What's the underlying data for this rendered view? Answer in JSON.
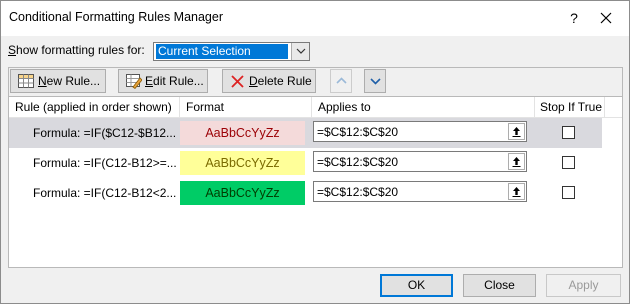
{
  "window": {
    "title": "Conditional Formatting Rules Manager",
    "help": "?"
  },
  "scope": {
    "label": "Show formatting rules for:",
    "selected": "Current Selection"
  },
  "toolbar": {
    "new_rule": "New Rule...",
    "edit_rule": "Edit Rule...",
    "delete_rule": "Delete Rule"
  },
  "table": {
    "headers": [
      "Rule (applied in order shown)",
      "Format",
      "Applies to",
      "Stop If True"
    ],
    "rows": [
      {
        "rule": "Formula: =IF($C12-$B12...",
        "format_preview": "AaBbCcYyZz",
        "format_bg": "#f4dada",
        "format_fg": "#9c0006",
        "applies_to": "=$C$12:$C$20",
        "stop_if_true": false,
        "selected": true
      },
      {
        "rule": "Formula: =IF(C12-B12>=...",
        "format_preview": "AaBbCcYyZz",
        "format_bg": "#ffff99",
        "format_fg": "#7a6a00",
        "applies_to": "=$C$12:$C$20",
        "stop_if_true": false,
        "selected": false
      },
      {
        "rule": "Formula: =IF(C12-B12<2...",
        "format_preview": "AaBbCcYyZz",
        "format_bg": "#00cc66",
        "format_fg": "#003d00",
        "applies_to": "=$C$12:$C$20",
        "stop_if_true": false,
        "selected": false
      }
    ]
  },
  "footer": {
    "ok": "OK",
    "close": "Close",
    "apply": "Apply"
  },
  "icons": [
    "new-rule-icon",
    "edit-rule-icon",
    "delete-x-icon",
    "move-up-icon",
    "move-down-icon",
    "collapse-dialog-icon",
    "close-icon",
    "dropdown-arrow-icon"
  ]
}
